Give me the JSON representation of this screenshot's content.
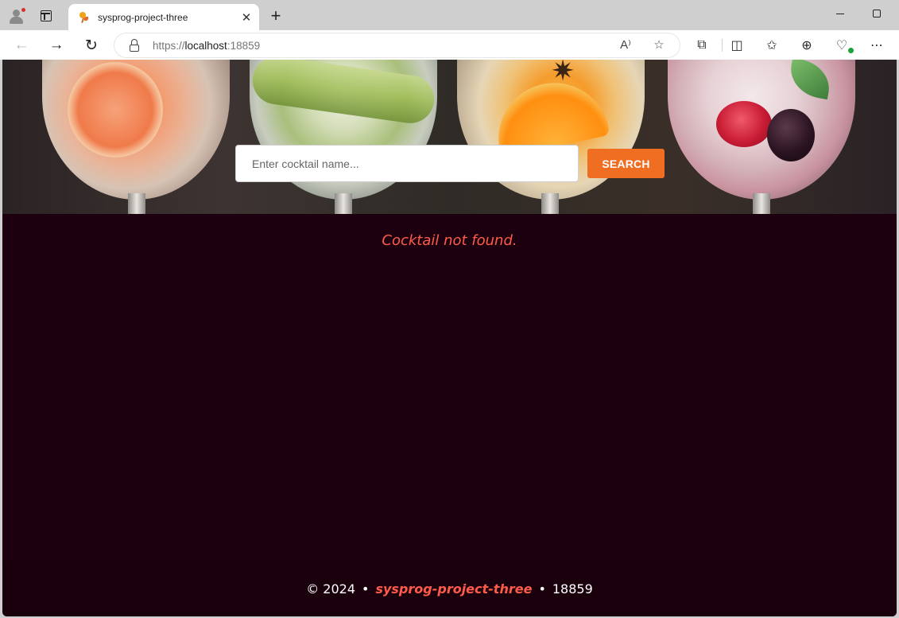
{
  "browser": {
    "tab_title": "sysprog-project-three",
    "close_glyph": "✕",
    "newtab_glyph": "+",
    "url_scheme": "https://",
    "url_host": "localhost",
    "url_port": ":18859",
    "read_aloud_glyph": "A⁾",
    "favorite_glyph": "☆",
    "back_glyph": "←",
    "forward_glyph": "→",
    "reload_glyph": "↻",
    "extensions_glyph": "⧉",
    "split_glyph": "◫",
    "favorites_glyph": "✩",
    "collections_glyph": "⊕",
    "performance_glyph": "♡",
    "more_glyph": "⋯"
  },
  "search": {
    "placeholder": "Enter cocktail name...",
    "button_label": "SEARCH"
  },
  "result": {
    "message": "Cocktail not found."
  },
  "footer": {
    "copyright": "© 2024",
    "separator": "•",
    "brand": "sysprog-project-three",
    "port": "18859"
  },
  "colors": {
    "page_bg": "#1d0010",
    "accent": "#ef6e22",
    "error_text": "#ff5b4a"
  }
}
